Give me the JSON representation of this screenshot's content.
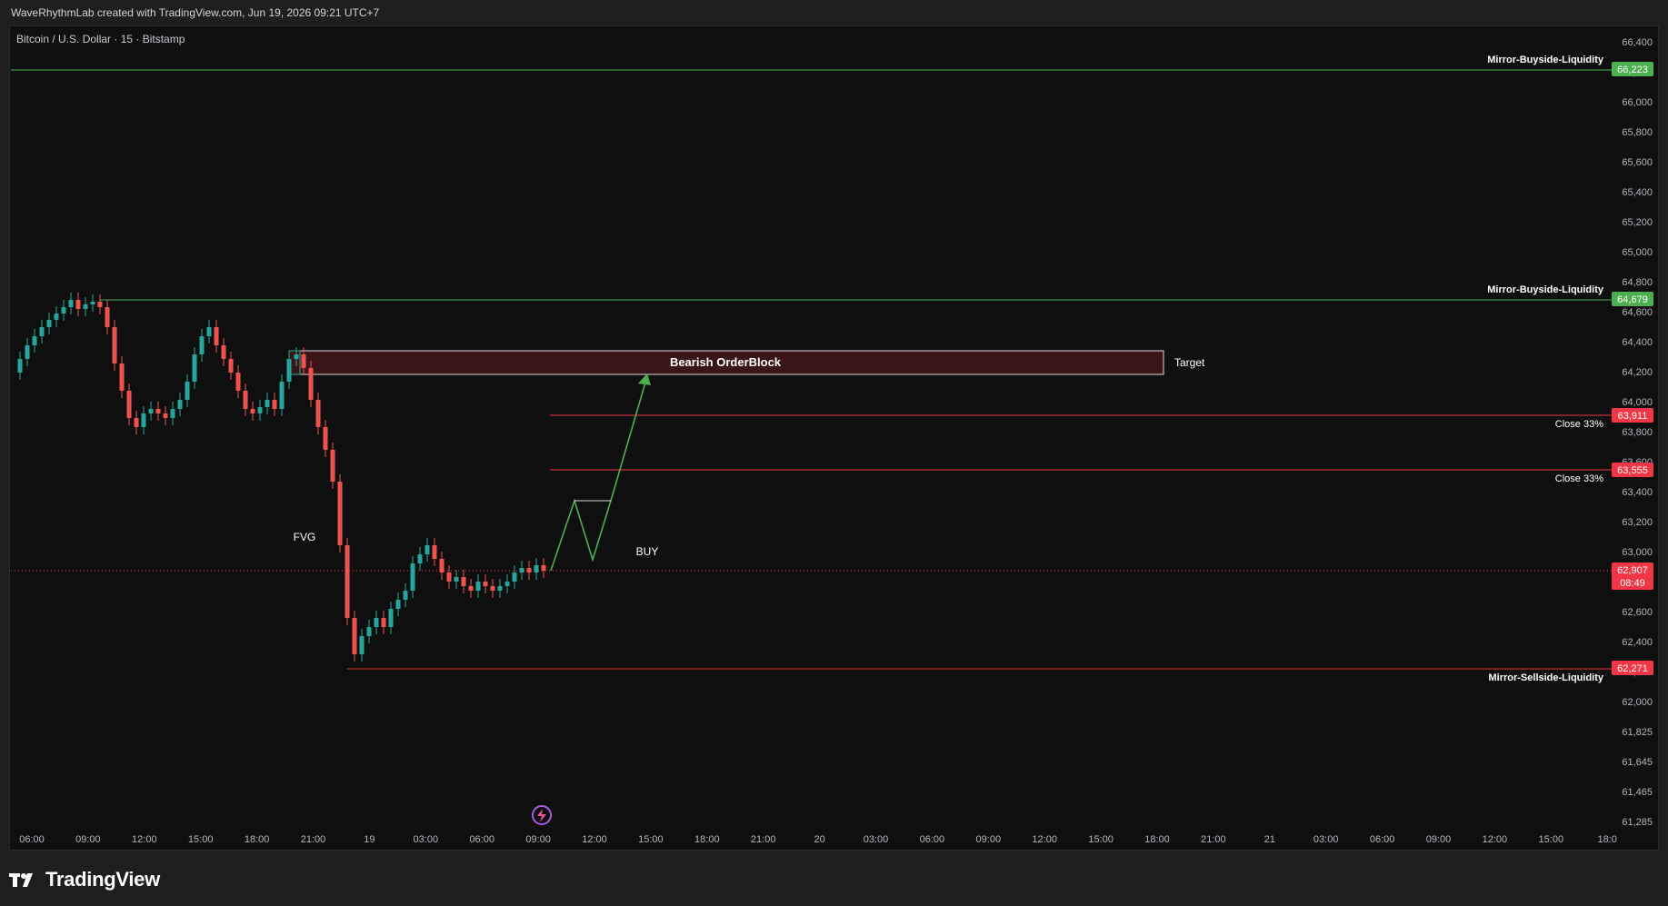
{
  "header": {
    "credit": "WaveRhythmLab created with TradingView.com, Jun 19, 2026 09:21 UTC+7",
    "symbol": "Bitcoin / U.S. Dollar · 15 · Bitstamp"
  },
  "footer": {
    "brand": "TradingView",
    "logo_icon": "tradingview-logo-icon"
  },
  "price_axis": {
    "ticks": [
      "66,400",
      "66,200",
      "66,000",
      "65,800",
      "65,600",
      "65,400",
      "65,200",
      "65,000",
      "64,800",
      "64,600",
      "64,400",
      "64,200",
      "64,000",
      "63,800",
      "63,600",
      "63,400",
      "63,200",
      "63,000",
      "62,800",
      "62,600",
      "62,400",
      "62,200",
      "62,000",
      "61,825",
      "61,645",
      "61,465",
      "61,285"
    ]
  },
  "time_axis": {
    "ticks": [
      "06:00",
      "09:00",
      "12:00",
      "15:00",
      "18:00",
      "21:00",
      "19",
      "03:00",
      "06:00",
      "09:00",
      "12:00",
      "15:00",
      "18:00",
      "21:00",
      "20",
      "03:00",
      "06:00",
      "09:00",
      "12:00",
      "15:00",
      "18:00",
      "21:00",
      "21",
      "03:00",
      "06:00",
      "09:00",
      "12:00",
      "15:00",
      "18:0"
    ]
  },
  "levels": [
    {
      "name": "Mirror-Buyside-Liquidity",
      "price": "66,223",
      "color": "#4caf50"
    },
    {
      "name": "Mirror-Buyside-Liquidity",
      "price": "64,679",
      "color": "#4caf50"
    },
    {
      "name": "Close 33%",
      "price": "63,911",
      "color": "#f23645"
    },
    {
      "name": "Close 33%",
      "price": "63,555",
      "color": "#f23645"
    },
    {
      "name": "Mirror-Sellside-Liquidity",
      "price": "62,271",
      "color": "#f23645"
    }
  ],
  "current_price": {
    "price": "62,907",
    "countdown": "08:49",
    "color": "#f23645"
  },
  "annotations": {
    "orderblock": "Bearish OrderBlock",
    "target": "Target",
    "fvg": "FVG",
    "buy": "BUY"
  },
  "colors": {
    "up": "#26a69a",
    "down": "#ef5350",
    "green_line": "#4caf50",
    "red_line": "#f23645"
  }
}
